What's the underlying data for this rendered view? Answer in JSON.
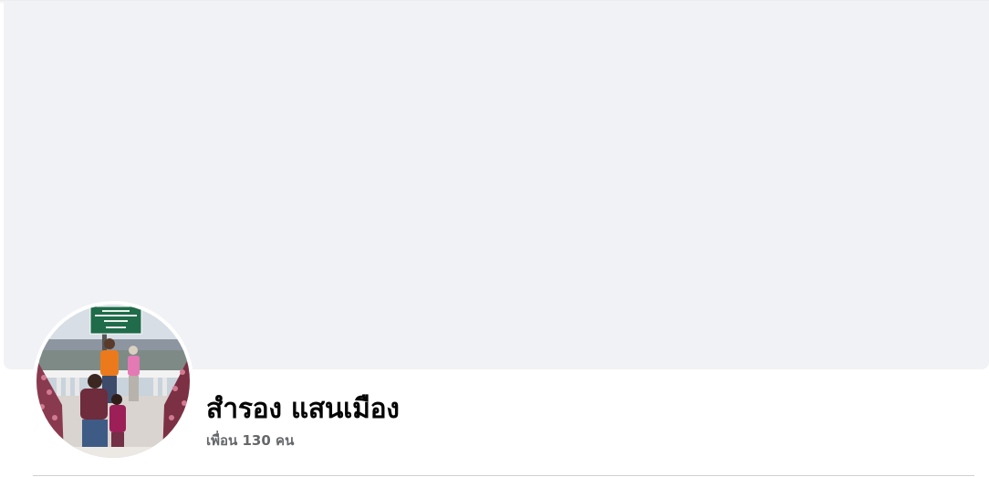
{
  "profile": {
    "name": "สำรอง แสนเมือง",
    "friends_count_text": "เพื่อน 130 คน"
  },
  "colors": {
    "page_background": "#ffffff",
    "cover_placeholder": "#f0f2f5",
    "name_text": "#050505",
    "secondary_text": "#65676b",
    "divider": "#ced0d4"
  },
  "avatar": {
    "sign_text_lines": [
      "สวนหลวงฯ",
      "(พระตำหนักภูพิงค์ราชนิเวศน์)",
      "ยินดีต้อนรับ",
      "Welcome"
    ]
  }
}
